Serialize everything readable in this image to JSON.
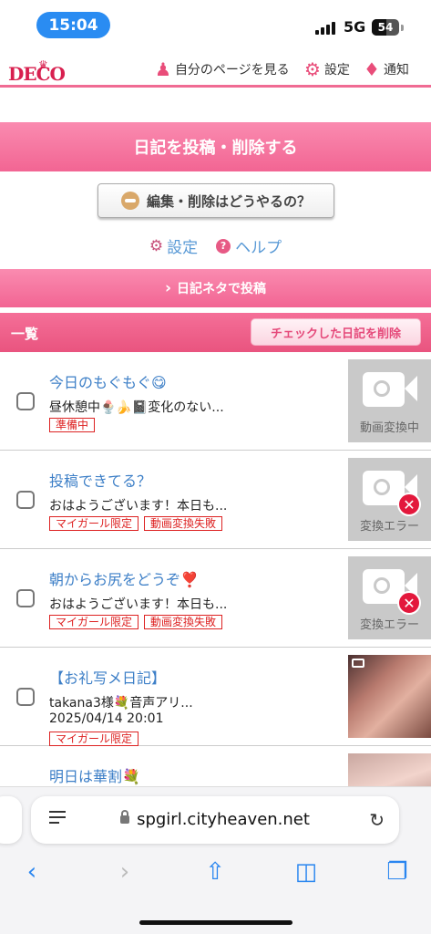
{
  "status_bar": {
    "time": "15:04",
    "network": "5G",
    "battery": "54",
    "battery_level": 0.54
  },
  "header": {
    "logo": "DECO",
    "my_page": "自分のページを見る",
    "settings": "設定",
    "notifications": "通知"
  },
  "diary_post_button": "日記を投稿・削除する",
  "howto_button": "編集・削除はどうやるの？",
  "links": {
    "settings": "設定",
    "help": "ヘルプ"
  },
  "neta_button": "日記ネタで投稿",
  "list": {
    "title": "一覧",
    "delete_checked": "チェックした日記を削除",
    "items": [
      {
        "title": "今日のもぐもぐ😋",
        "excerpt": "昼休憩中🍨🍌📓変化のない...",
        "date": "",
        "tags": [
          "準備中"
        ],
        "thumb_label": "動画変換中"
      },
      {
        "title": "投稿できてる？",
        "excerpt": "おはようございます！本日も...",
        "date": "",
        "tags": [
          "マイガール限定",
          "動画変換失敗"
        ],
        "thumb_label": "変換エラー"
      },
      {
        "title": "朝からお尻をどうぞ❣️",
        "excerpt": "おはようございます！本日も...",
        "date": "",
        "tags": [
          "マイガール限定",
          "動画変換失敗"
        ],
        "thumb_label": "変換エラー"
      },
      {
        "title": "【お礼写メ日記】",
        "excerpt": "takana3様💐音声アリ...",
        "date": "2025/04/14 20:01",
        "tags": [
          "マイガール限定"
        ],
        "thumb_label": ""
      },
      {
        "title": "明日は華割💐",
        "excerpt": "",
        "date": "",
        "tags": [],
        "thumb_label": ""
      }
    ]
  },
  "browser": {
    "url": "spgirl.cityheaven.net"
  },
  "icons": [
    "user-icon",
    "gear-icon",
    "bell-icon",
    "camera-icon",
    "error-icon",
    "lock-icon",
    "reload-icon",
    "back-icon",
    "forward-icon",
    "share-icon",
    "bookmarks-icon",
    "tabs-icon"
  ],
  "colors": {
    "accent": "#f26593",
    "link": "#3d7fc7",
    "tag": "#dd2222",
    "ios_blue": "#2a86f0"
  }
}
